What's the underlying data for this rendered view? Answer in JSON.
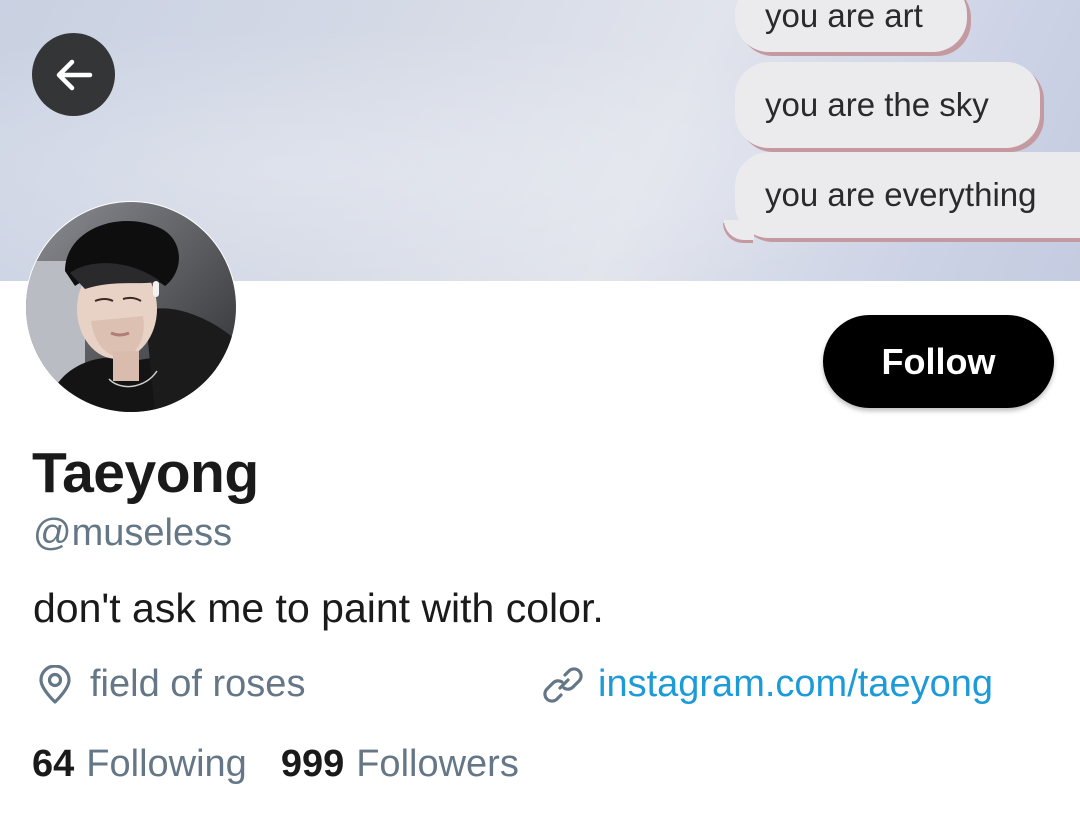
{
  "banner": {
    "messages": [
      "you are art",
      "you are the sky",
      "you are everything"
    ]
  },
  "nav": {
    "back_icon": "arrow-left-icon"
  },
  "profile": {
    "display_name": "Taeyong",
    "handle": "@museless",
    "bio": "don't ask me to paint with color.",
    "location": "field of roses",
    "website": "instagram.com/taeyong",
    "following_count": "64",
    "following_label": "Following",
    "followers_count": "999",
    "followers_label": "Followers"
  },
  "actions": {
    "follow_label": "Follow"
  },
  "icons": {
    "location": "location-pin-icon",
    "website": "link-icon",
    "back": "arrow-left-icon"
  },
  "colors": {
    "link": "#1d9bd8",
    "secondary_text": "#657786",
    "follow_button": "#000000"
  }
}
